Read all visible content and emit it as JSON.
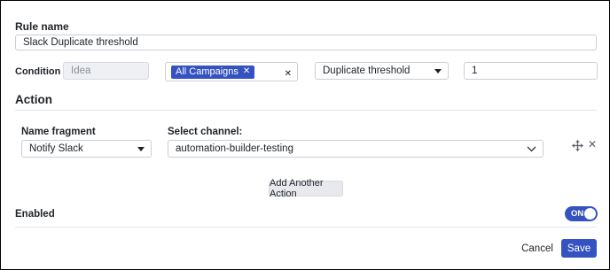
{
  "form": {
    "rule_name_label": "Rule name",
    "rule_name_value": "Slack Duplicate threshold"
  },
  "condition": {
    "label": "Condition",
    "entity_placeholder": "Idea",
    "campaign_chip": "All Campaigns",
    "metric_value": "Duplicate threshold",
    "threshold_value": "1"
  },
  "action": {
    "title": "Action",
    "name_fragment_label": "Name fragment",
    "name_fragment_value": "Notify Slack",
    "channel_label": "Select channel:",
    "channel_value": "automation-builder-testing",
    "add_action_label": "Add Another Action"
  },
  "enabled": {
    "label": "Enabled",
    "toggle_text": "ON",
    "state": true
  },
  "footer": {
    "cancel_label": "Cancel",
    "save_label": "Save"
  },
  "icons": {
    "chip_remove": "close-icon",
    "clear_selection": "close-icon",
    "dropdown": "chevron-down-icon",
    "drag": "move-icon",
    "remove_action": "close-icon"
  },
  "colors": {
    "primary": "#3452c0",
    "disabled_bg": "#eef0f3",
    "border": "#c9ced6"
  }
}
